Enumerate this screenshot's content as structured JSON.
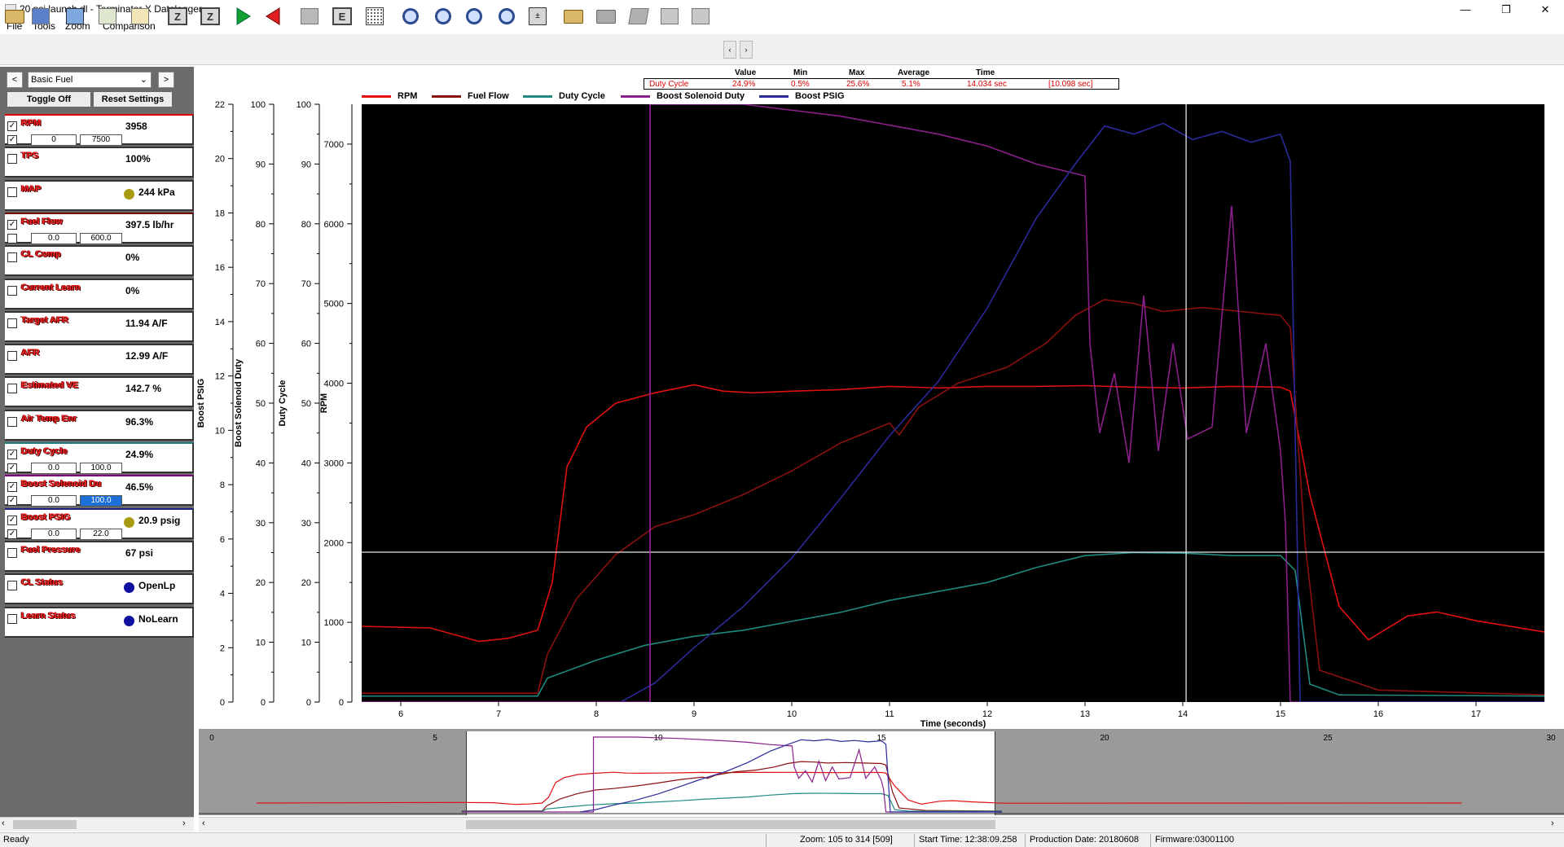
{
  "window": {
    "title": "20 psi launch.dl - Terminator X Datalogger",
    "buttons": {
      "minimize": "—",
      "maximize": "❐",
      "close": "✕"
    }
  },
  "menu": [
    "File",
    "Tools",
    "Zoom",
    "Comparison"
  ],
  "toolbar": {
    "icons": [
      "open-folder-icon",
      "save-icon",
      "new-log-icon",
      "export-icon",
      "notes-icon",
      "zoom-a-icon",
      "zoom-z-icon",
      "play-forward-icon",
      "play-back-icon",
      "stop-icon",
      "e-icon",
      "grid-icon",
      "zoom-in-icon",
      "zoom-out-icon",
      "zoom-fit-icon",
      "zoom-range-icon",
      "calculator-icon",
      "folder-open-icon",
      "folder-icon",
      "edit-icon",
      "blank-icon",
      "blank2-icon"
    ],
    "left_arrow": "‹",
    "right_arrow": "›"
  },
  "left_panel": {
    "nav_prev": "<",
    "nav_next": ">",
    "profile": "Basic Fuel",
    "dropdown_arrow": "⌄",
    "toggle_label": "Toggle Off",
    "reset_label": "Reset Settings",
    "channels": [
      {
        "name": "RPM",
        "value": "3958",
        "checked": true,
        "range": true,
        "range_checked": true,
        "min": "0",
        "max": "7500",
        "border": "#e00000",
        "dot": ""
      },
      {
        "name": "TPS",
        "value": "100%",
        "checked": false,
        "range": false,
        "border": "#333333",
        "dot": ""
      },
      {
        "name": "MAP",
        "value": "244 kPa",
        "checked": false,
        "range": false,
        "border": "#333333",
        "dot": "#a89a10"
      },
      {
        "name": "Fuel Flow",
        "value": "397.5 lb/hr",
        "checked": true,
        "range": true,
        "range_checked": false,
        "min": "0.0",
        "max": "600.0",
        "border": "#700000",
        "dot": ""
      },
      {
        "name": "CL Comp",
        "value": "0%",
        "checked": false,
        "range": false,
        "border": "#333333",
        "dot": ""
      },
      {
        "name": "Current Learn",
        "value": "0%",
        "checked": false,
        "range": false,
        "border": "#333333",
        "dot": ""
      },
      {
        "name": "Target AFR",
        "value": "11.94 A/F",
        "checked": false,
        "range": false,
        "border": "#333333",
        "dot": ""
      },
      {
        "name": "AFR",
        "value": "12.99 A/F",
        "checked": false,
        "range": false,
        "border": "#333333",
        "dot": ""
      },
      {
        "name": "Estimated VE",
        "value": "142.7 %",
        "checked": false,
        "range": false,
        "border": "#333333",
        "dot": ""
      },
      {
        "name": "Air Temp Enr",
        "value": "96.3%",
        "checked": false,
        "range": false,
        "border": "#333333",
        "dot": ""
      },
      {
        "name": "Duty Cycle",
        "value": "24.9%",
        "checked": true,
        "range": true,
        "range_checked": true,
        "min": "0.0",
        "max": "100.0",
        "border": "#1e8080",
        "dot": ""
      },
      {
        "name": "Boost Solenoid Du",
        "value": "46.5%",
        "checked": true,
        "range": true,
        "range_checked": true,
        "min": "0.0",
        "max": "100.0",
        "border": "#800080",
        "dot": "",
        "max_selected": true
      },
      {
        "name": "Boost PSIG",
        "value": "20.9 psig",
        "checked": true,
        "range": true,
        "range_checked": true,
        "min": "0.0",
        "max": "22.0",
        "border": "#202080",
        "dot": "#a89a10"
      },
      {
        "name": "Fuel Pressure",
        "value": "67 psi",
        "checked": false,
        "range": false,
        "border": "#333333",
        "dot": ""
      },
      {
        "name": "CL Status",
        "value": "OpenLp",
        "checked": false,
        "range": false,
        "border": "#333333",
        "dot": "#1010a0"
      },
      {
        "name": "Learn Status",
        "value": "NoLearn",
        "checked": false,
        "range": false,
        "border": "#333333",
        "dot": "#1010a0"
      }
    ],
    "scroll_left": "‹",
    "scroll_right": "›"
  },
  "stats": {
    "headers": [
      "Value",
      "Min",
      "Max",
      "Average",
      "Time"
    ],
    "row": {
      "name": "Duty Cycle",
      "value": "24.9%",
      "min": "0.5%",
      "max": "25.6%",
      "average": "5.1%",
      "time": "14.034 sec",
      "span": "[10.098 sec]"
    }
  },
  "legend": [
    {
      "name": "RPM",
      "color": "#e01010"
    },
    {
      "name": "Fuel Flow",
      "color": "#8a1010"
    },
    {
      "name": "Duty Cycle",
      "color": "#1e8a80"
    },
    {
      "name": "Boost Solenoid Duty",
      "color": "#8a208a"
    },
    {
      "name": "Boost PSIG",
      "color": "#2a2a9a"
    }
  ],
  "chart_data": {
    "type": "line",
    "xlabel": "Time (seconds)",
    "xlim": [
      5.6,
      17.7
    ],
    "xticks": [
      6,
      7,
      8,
      9,
      10,
      11,
      12,
      13,
      14,
      15,
      16,
      17
    ],
    "axes": [
      {
        "label": "Boost PSIG",
        "ylim": [
          0,
          22
        ],
        "ticks": [
          0,
          2,
          4,
          6,
          8,
          10,
          12,
          14,
          16,
          18,
          20,
          22
        ]
      },
      {
        "label": "Boost Solenoid Duty",
        "ylim": [
          0,
          100
        ],
        "ticks": [
          0,
          10,
          20,
          30,
          40,
          50,
          60,
          70,
          80,
          90,
          100
        ]
      },
      {
        "label": "Duty Cycle",
        "ylim": [
          0,
          100
        ],
        "ticks": [
          0,
          10,
          20,
          30,
          40,
          50,
          60,
          70,
          80,
          90,
          100
        ]
      },
      {
        "label": "RPM",
        "ylim": [
          0,
          7500
        ],
        "ticks": [
          0,
          1000,
          2000,
          3000,
          4000,
          5000,
          6000,
          7000
        ]
      }
    ],
    "cursor": {
      "x": 14.034,
      "rpm_level": 1880
    },
    "marker_x": 8.55,
    "series": [
      {
        "name": "RPM",
        "color": "#e01010",
        "axis": 3,
        "x": [
          5.6,
          6.3,
          6.8,
          7.1,
          7.4,
          7.55,
          7.7,
          7.9,
          8.2,
          8.6,
          9.0,
          9.3,
          9.6,
          10.0,
          10.5,
          11.0,
          11.5,
          12.0,
          12.5,
          13.0,
          13.5,
          14.0,
          14.5,
          15.0,
          15.1,
          15.3,
          15.6,
          15.9,
          16.3,
          16.6,
          17.0,
          17.7
        ],
        "y": [
          950,
          930,
          760,
          800,
          900,
          1500,
          2950,
          3450,
          3750,
          3880,
          3980,
          3900,
          3880,
          3900,
          3920,
          3960,
          3940,
          3960,
          3960,
          3970,
          3950,
          3940,
          3960,
          3950,
          3900,
          2600,
          1200,
          780,
          1080,
          1130,
          1020,
          880
        ]
      },
      {
        "name": "Fuel Flow",
        "color": "#8a1010",
        "axis": 3,
        "x": [
          5.6,
          7.4,
          7.5,
          7.8,
          8.2,
          8.6,
          9.0,
          9.5,
          10.0,
          10.5,
          11.0,
          11.1,
          11.3,
          11.7,
          12.2,
          12.6,
          12.9,
          13.2,
          13.5,
          13.8,
          14.2,
          14.6,
          15.0,
          15.1,
          15.25,
          15.4,
          16.0,
          17.7
        ],
        "y": [
          110,
          110,
          600,
          1300,
          1850,
          2200,
          2350,
          2600,
          2900,
          3250,
          3500,
          3350,
          3700,
          4000,
          4200,
          4500,
          4850,
          5050,
          5000,
          4900,
          4950,
          4900,
          4850,
          4700,
          2000,
          400,
          150,
          90
        ]
      },
      {
        "name": "Duty Cycle",
        "color": "#1e8a80",
        "axis": 2,
        "x": [
          5.6,
          7.4,
          7.5,
          8.0,
          8.5,
          9.0,
          9.5,
          10.0,
          10.5,
          11.0,
          11.5,
          12.0,
          12.5,
          13.0,
          13.5,
          14.0,
          14.5,
          15.0,
          15.15,
          15.3,
          15.6,
          17.7
        ],
        "y": [
          1,
          1,
          4,
          7,
          9.5,
          11,
          12,
          13.5,
          15,
          17,
          18.5,
          20,
          22.5,
          24.5,
          25,
          24.9,
          24.5,
          24.5,
          22,
          3,
          1.2,
          1
        ]
      },
      {
        "name": "Boost Solenoid Duty",
        "color": "#8a208a",
        "axis": 1,
        "x": [
          5.6,
          8.55,
          8.55,
          9.5,
          10.5,
          11.5,
          12.0,
          12.5,
          13.0,
          13.05,
          13.15,
          13.3,
          13.45,
          13.6,
          13.75,
          13.9,
          14.05,
          14.3,
          14.5,
          14.65,
          14.85,
          15.0,
          15.05,
          15.1,
          17.7
        ],
        "y": [
          0,
          0,
          100,
          100,
          98,
          95,
          93,
          90,
          88,
          60,
          45,
          55,
          40,
          68,
          42,
          60,
          44,
          46,
          83,
          45,
          60,
          42,
          30,
          0,
          0
        ]
      },
      {
        "name": "Boost PSIG",
        "color": "#2a2a9a",
        "axis": 0,
        "x": [
          8.25,
          8.6,
          9.0,
          9.5,
          10.0,
          10.5,
          11.0,
          11.5,
          12.0,
          12.5,
          12.9,
          13.2,
          13.5,
          13.8,
          14.1,
          14.4,
          14.7,
          15.0,
          15.1,
          15.2,
          17.7
        ],
        "y": [
          0,
          0.7,
          2,
          3.5,
          5.3,
          7.5,
          9.8,
          11.8,
          14.5,
          17.8,
          19.8,
          21.2,
          20.9,
          21.3,
          20.7,
          21.0,
          20.6,
          20.9,
          19.9,
          0,
          0
        ]
      }
    ],
    "overview": {
      "xlim": [
        0,
        30
      ],
      "xticks": [
        0,
        5,
        10,
        15,
        20,
        25,
        30
      ],
      "window": [
        5.6,
        17.7
      ]
    }
  },
  "statusbar": {
    "ready": "Ready",
    "zoom": "Zoom: 105 to 314 [509]",
    "start_time": "Start Time: 12:38:09.258",
    "production_date": "Production Date: 20180608",
    "firmware": "Firmware:03001100"
  }
}
